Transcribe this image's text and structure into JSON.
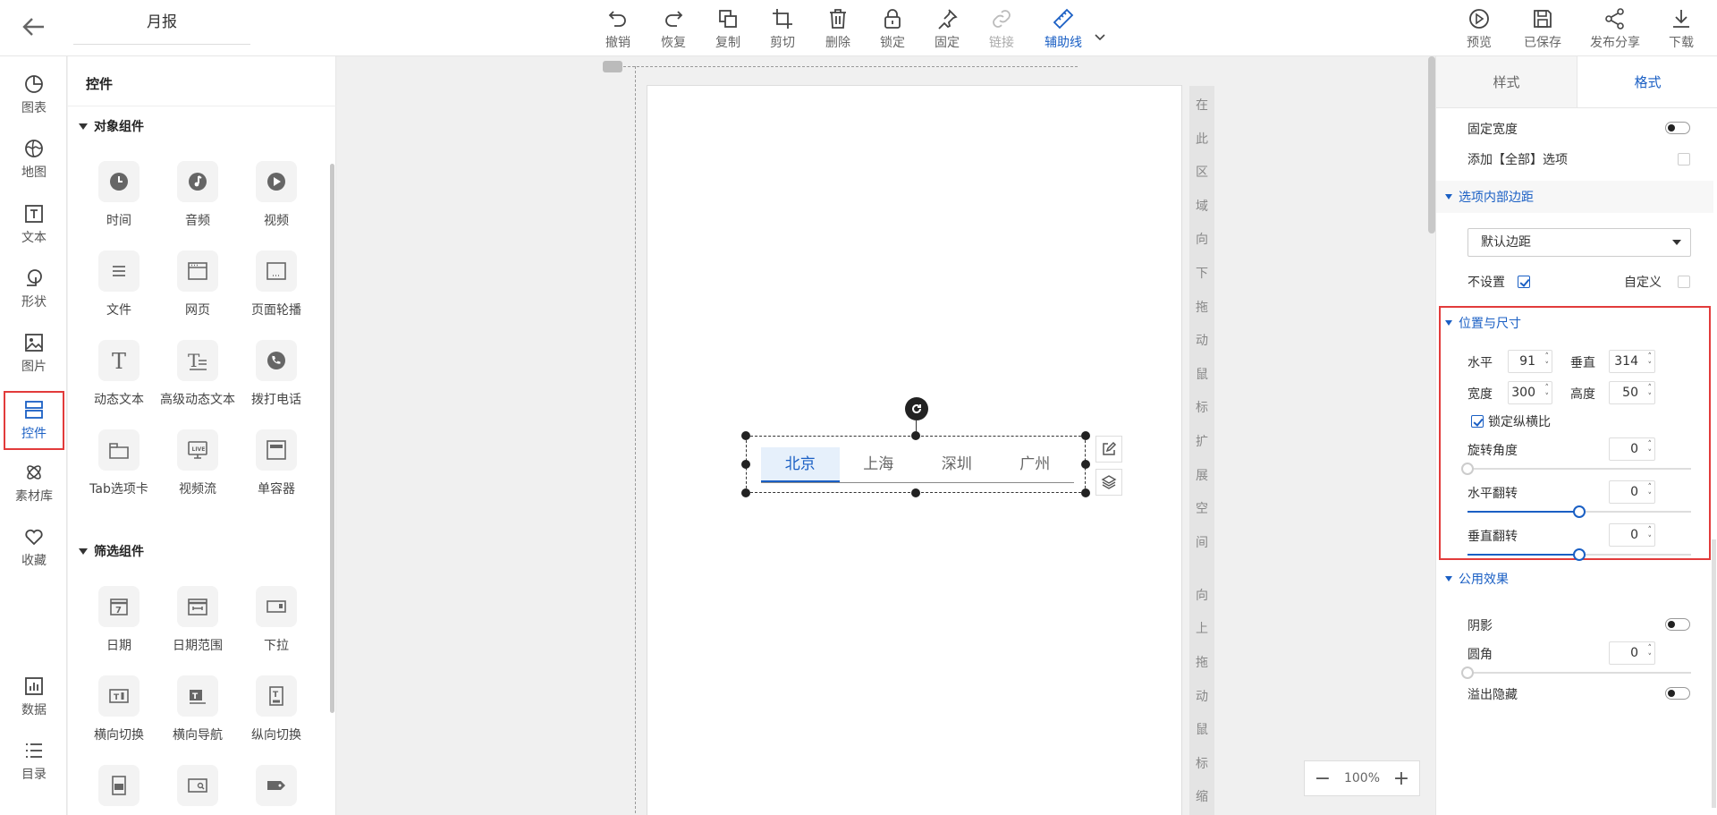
{
  "header": {
    "report_name": "月报",
    "tools": [
      {
        "id": "undo",
        "label": "撤销"
      },
      {
        "id": "redo",
        "label": "恢复"
      },
      {
        "id": "copy",
        "label": "复制"
      },
      {
        "id": "cut",
        "label": "剪切"
      },
      {
        "id": "delete",
        "label": "删除"
      },
      {
        "id": "lock",
        "label": "锁定"
      },
      {
        "id": "pin",
        "label": "固定"
      },
      {
        "id": "link",
        "label": "链接"
      },
      {
        "id": "guides",
        "label": "辅助线"
      }
    ],
    "right_tools": [
      {
        "id": "preview",
        "label": "预览"
      },
      {
        "id": "save",
        "label": "已保存"
      },
      {
        "id": "share",
        "label": "发布分享"
      },
      {
        "id": "download",
        "label": "下载"
      }
    ]
  },
  "leftnav": {
    "items": [
      {
        "label": "图表",
        "icon": "pie-chart-icon"
      },
      {
        "label": "地图",
        "icon": "map-icon"
      },
      {
        "label": "文本",
        "icon": "text-icon"
      },
      {
        "label": "形状",
        "icon": "shape-icon"
      },
      {
        "label": "图片",
        "icon": "image-icon"
      },
      {
        "label": "控件",
        "icon": "widget-icon"
      },
      {
        "label": "素材库",
        "icon": "asset-library-icon"
      },
      {
        "label": "收藏",
        "icon": "heart-icon"
      }
    ],
    "bottom_items": [
      {
        "label": "数据",
        "icon": "bar-chart-icon"
      },
      {
        "label": "目录",
        "icon": "list-icon"
      }
    ],
    "active": "控件"
  },
  "widget_panel": {
    "title": "控件",
    "sections": [
      {
        "title": "对象组件",
        "items": [
          "时间",
          "音频",
          "视频",
          "文件",
          "网页",
          "页面轮播",
          "动态文本",
          "高级动态文本",
          "拨打电话",
          "Tab选项卡",
          "视频流",
          "单容器"
        ]
      },
      {
        "title": "筛选组件",
        "items": [
          "日期",
          "日期范围",
          "下拉",
          "横向切换",
          "横向导航",
          "纵向切换",
          "",
          "",
          ""
        ]
      }
    ],
    "live_badge": "LIVE"
  },
  "canvas": {
    "vertical_hint": [
      "在",
      "此",
      "区",
      "域",
      "向",
      "下",
      "拖",
      "动",
      "鼠",
      "标",
      "扩",
      "展",
      "空",
      "间",
      "",
      "向",
      "上",
      "拖",
      "动",
      "鼠",
      "标",
      "缩"
    ],
    "tabs": [
      "北京",
      "上海",
      "深圳",
      "广州"
    ],
    "active_tab": "北京",
    "zoom": "100%"
  },
  "right_panel": {
    "tabs": [
      "样式",
      "格式"
    ],
    "active_tab": "格式",
    "fixed_width_label": "固定宽度",
    "add_all_label": "添加【全部】选项",
    "padding_section": "选项内部边距",
    "padding_select": "默认边距",
    "no_setting_label": "不设置",
    "custom_label": "自定义",
    "position_section": "位置与尺寸",
    "horizontal_label": "水平",
    "horizontal_value": "91",
    "vertical_label": "垂直",
    "vertical_value": "314",
    "width_label": "宽度",
    "width_value": "300",
    "height_label": "高度",
    "height_value": "50",
    "lock_ratio_label": "锁定纵横比",
    "rotation_label": "旋转角度",
    "rotation_value": "0",
    "hflip_label": "水平翻转",
    "hflip_value": "0",
    "vflip_label": "垂直翻转",
    "vflip_value": "0",
    "effects_section": "公用效果",
    "shadow_label": "阴影",
    "radius_label": "圆角",
    "radius_value": "0",
    "overflow_label": "溢出隐藏"
  },
  "colors": {
    "accent": "#1a5fc4",
    "highlight": "#e23b3b"
  }
}
